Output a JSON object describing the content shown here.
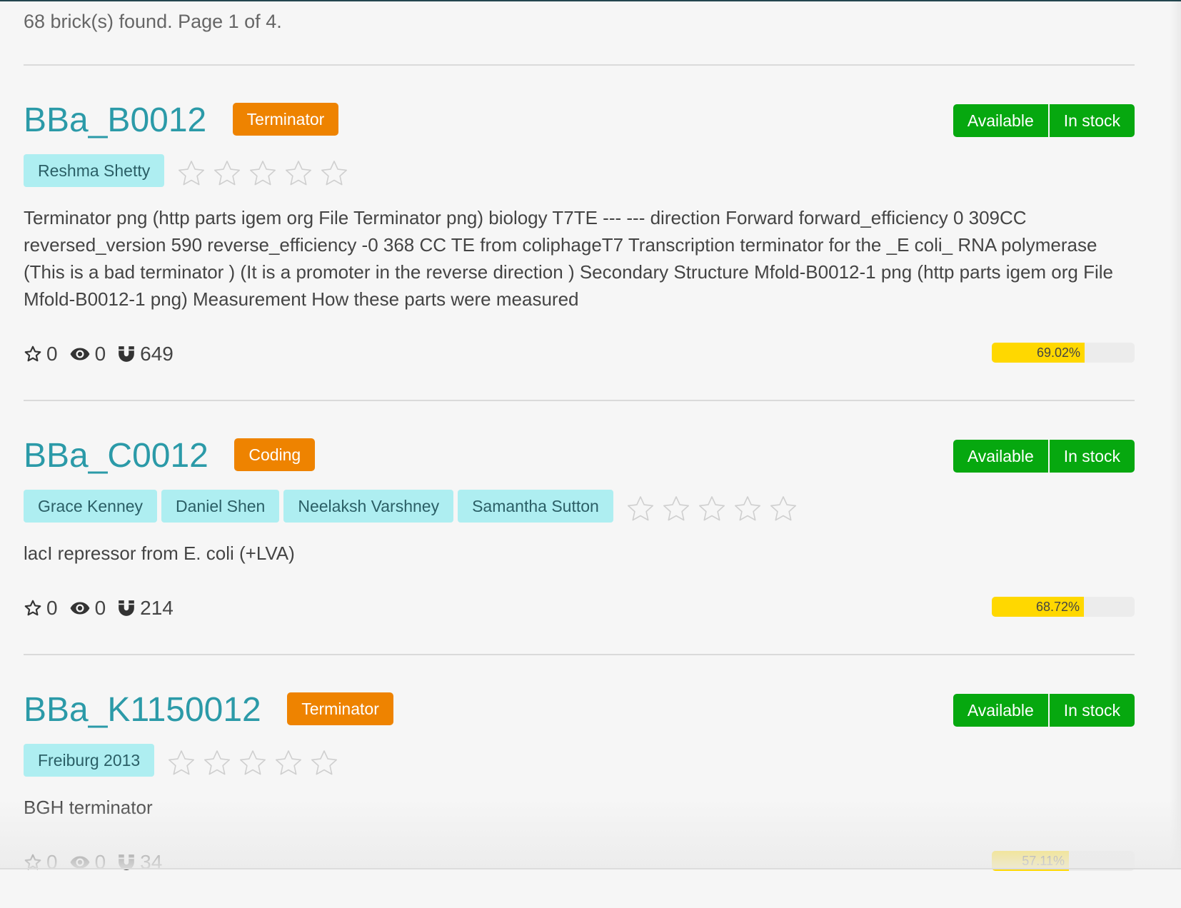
{
  "summary": "68 brick(s) found. Page 1 of 4.",
  "colors": {
    "link": "#2b9aa8",
    "type_badge": "#ee8300",
    "status": "#06a80f",
    "author_tag": "#aeeef1",
    "progress": "#ffd800"
  },
  "bricks": [
    {
      "name": "BBa_B0012",
      "type": "Terminator",
      "status": [
        "Available",
        "In stock"
      ],
      "authors": [
        "Reshma Shetty"
      ],
      "rating": 0,
      "description": "Terminator png (http parts igem org File Terminator png) biology T7TE --- --- direction Forward forward_efficiency 0 309CC reversed_version 590 reverse_efficiency -0 368 CC TE from coliphageT7 Transcription terminator for the _E coli_ RNA polymerase (This is a bad terminator ) (It is a promoter in the reverse direction ) Secondary Structure Mfold-B0012-1 png (http parts igem org File Mfold-B0012-1 png) Measurement How these parts were measured",
      "stars": "0",
      "views": "0",
      "uses": "649",
      "score": 69.02,
      "score_label": "69.02%"
    },
    {
      "name": "BBa_C0012",
      "type": "Coding",
      "status": [
        "Available",
        "In stock"
      ],
      "authors": [
        "Grace Kenney",
        "Daniel Shen",
        "Neelaksh Varshney",
        "Samantha Sutton"
      ],
      "rating": 0,
      "description": "lacI repressor from E. coli (+LVA)",
      "stars": "0",
      "views": "0",
      "uses": "214",
      "score": 68.72,
      "score_label": "68.72%"
    },
    {
      "name": "BBa_K1150012",
      "type": "Terminator",
      "status": [
        "Available",
        "In stock"
      ],
      "authors": [
        "Freiburg 2013"
      ],
      "rating": 0,
      "description": "BGH terminator",
      "stars": "0",
      "views": "0",
      "uses": "34",
      "score": 57.11,
      "score_label": "57.11%"
    }
  ]
}
